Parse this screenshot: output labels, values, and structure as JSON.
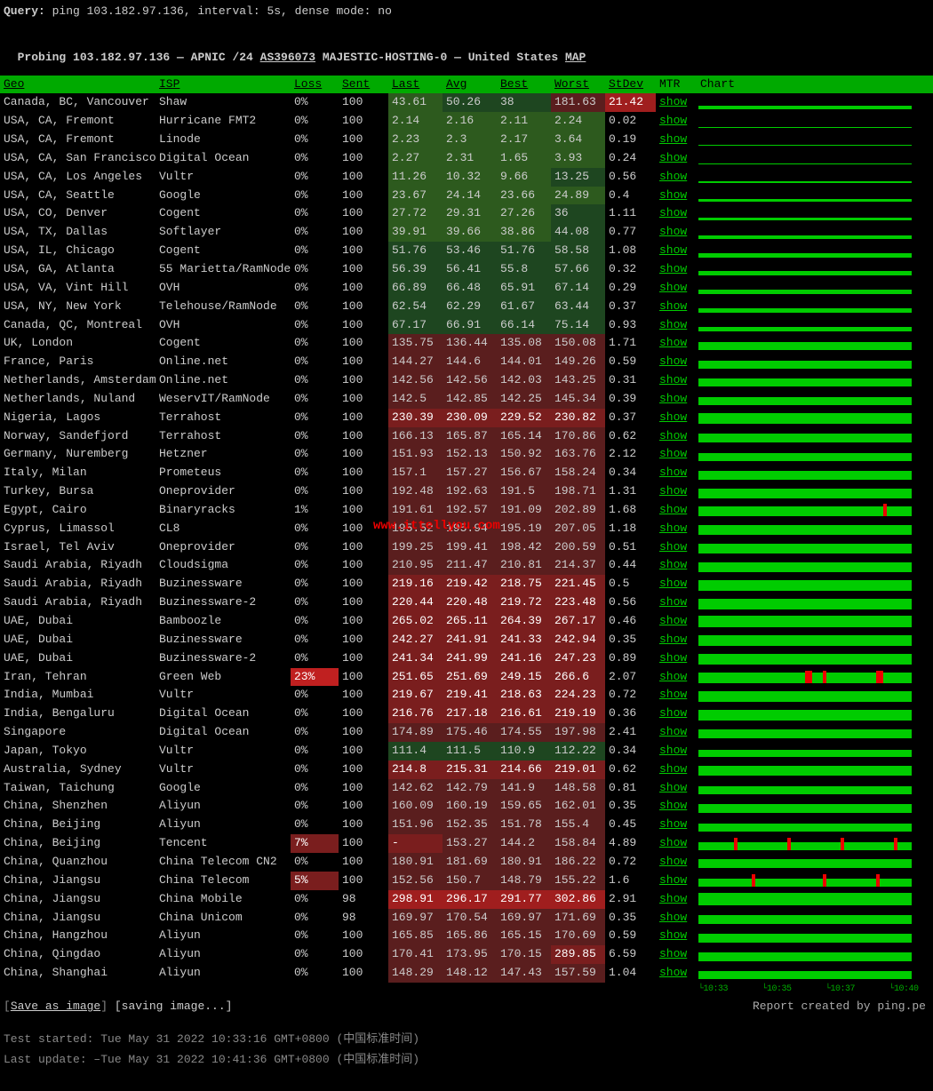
{
  "header": {
    "query_label": "Query: ",
    "query_value": "ping 103.182.97.136, interval: 5s, dense mode: no",
    "probe_line_prefix": "Probing 103.182.97.136 — APNIC /24 ",
    "asn": "AS396073",
    "probe_line_mid": " MAJESTIC-HOSTING-0 — United States ",
    "map": "MAP"
  },
  "columns": {
    "geo": "Geo",
    "isp": "ISP",
    "loss": "Loss",
    "sent": "Sent",
    "last": "Last",
    "avg": "Avg",
    "best": "Best",
    "worst": "Worst",
    "stdev": "StDev",
    "mtr": "MTR",
    "chart": "Chart"
  },
  "mtr_label": "show",
  "watermark": "www.ittellyou.com",
  "axis_labels": [
    "10:33",
    "10:35",
    "10:37",
    "10:40"
  ],
  "footer": {
    "save": "Save as image",
    "saving": "[saving image...]",
    "report_by": "Report created by ping.pe",
    "started_label": "Test started: ",
    "started": "Tue May 31 2022 10:33:16 GMT+0800 (中国标准时间)",
    "updated_label": "Last update: –",
    "updated": "Tue May 31 2022 10:41:36 GMT+0800 (中国标准时间)"
  },
  "rows": [
    {
      "geo": "Canada, BC, Vancouver",
      "isp": "Shaw",
      "loss": "0%",
      "sent": "100",
      "last": "43.61",
      "avg": "50.26",
      "best": "38",
      "worst": "181.63",
      "stdev": "21.42",
      "stc": "r2",
      "pc": [
        "g1",
        "g0",
        "g0",
        "r0"
      ],
      "ch": {
        "h": 4,
        "loss": []
      }
    },
    {
      "geo": "USA, CA, Fremont",
      "isp": "Hurricane FMT2",
      "loss": "0%",
      "sent": "100",
      "last": "2.14",
      "avg": "2.16",
      "best": "2.11",
      "worst": "2.24",
      "stdev": "0.02",
      "pc": [
        "g1",
        "g1",
        "g1",
        "g1"
      ],
      "ch": {
        "h": 1,
        "loss": []
      }
    },
    {
      "geo": "USA, CA, Fremont",
      "isp": "Linode",
      "loss": "0%",
      "sent": "100",
      "last": "2.23",
      "avg": "2.3",
      "best": "2.17",
      "worst": "3.64",
      "stdev": "0.19",
      "pc": [
        "g1",
        "g1",
        "g1",
        "g1"
      ],
      "ch": {
        "h": 1,
        "loss": []
      }
    },
    {
      "geo": "USA, CA, San Francisco",
      "isp": "Digital Ocean",
      "loss": "0%",
      "sent": "100",
      "last": "2.27",
      "avg": "2.31",
      "best": "1.65",
      "worst": "3.93",
      "stdev": "0.24",
      "pc": [
        "g1",
        "g1",
        "g1",
        "g1"
      ],
      "ch": {
        "h": 1,
        "loss": []
      }
    },
    {
      "geo": "USA, CA, Los Angeles",
      "isp": "Vultr",
      "loss": "0%",
      "sent": "100",
      "last": "11.26",
      "avg": "10.32",
      "best": "9.66",
      "worst": "13.25",
      "stdev": "0.56",
      "pc": [
        "g1",
        "g1",
        "g1",
        "g0"
      ],
      "ch": {
        "h": 2,
        "loss": []
      }
    },
    {
      "geo": "USA, CA, Seattle",
      "isp": "Google",
      "loss": "0%",
      "sent": "100",
      "last": "23.67",
      "avg": "24.14",
      "best": "23.66",
      "worst": "24.89",
      "stdev": "0.4",
      "pc": [
        "g1",
        "g1",
        "g1",
        "g1"
      ],
      "ch": {
        "h": 3,
        "loss": []
      }
    },
    {
      "geo": "USA, CO, Denver",
      "isp": "Cogent",
      "loss": "0%",
      "sent": "100",
      "last": "27.72",
      "avg": "29.31",
      "best": "27.26",
      "worst": "36",
      "stdev": "1.11",
      "pc": [
        "g1",
        "g1",
        "g1",
        "g0"
      ],
      "ch": {
        "h": 3,
        "loss": []
      }
    },
    {
      "geo": "USA, TX, Dallas",
      "isp": "Softlayer",
      "loss": "0%",
      "sent": "100",
      "last": "39.91",
      "avg": "39.66",
      "best": "38.86",
      "worst": "44.08",
      "stdev": "0.77",
      "pc": [
        "g1",
        "g1",
        "g1",
        "g0"
      ],
      "ch": {
        "h": 4,
        "loss": []
      }
    },
    {
      "geo": "USA, IL, Chicago",
      "isp": "Cogent",
      "loss": "0%",
      "sent": "100",
      "last": "51.76",
      "avg": "53.46",
      "best": "51.76",
      "worst": "58.58",
      "stdev": "1.08",
      "pc": [
        "g0",
        "g0",
        "g0",
        "g0"
      ],
      "ch": {
        "h": 5,
        "loss": []
      }
    },
    {
      "geo": "USA, GA, Atlanta",
      "isp": "55 Marietta/RamNode",
      "loss": "0%",
      "sent": "100",
      "last": "56.39",
      "avg": "56.41",
      "best": "55.8",
      "worst": "57.66",
      "stdev": "0.32",
      "pc": [
        "g0",
        "g0",
        "g0",
        "g0"
      ],
      "ch": {
        "h": 5,
        "loss": []
      }
    },
    {
      "geo": "USA, VA, Vint Hill",
      "isp": "OVH",
      "loss": "0%",
      "sent": "100",
      "last": "66.89",
      "avg": "66.48",
      "best": "65.91",
      "worst": "67.14",
      "stdev": "0.29",
      "pc": [
        "g0",
        "g0",
        "g0",
        "g0"
      ],
      "ch": {
        "h": 5,
        "loss": []
      }
    },
    {
      "geo": "USA, NY, New York",
      "isp": "Telehouse/RamNode",
      "loss": "0%",
      "sent": "100",
      "last": "62.54",
      "avg": "62.29",
      "best": "61.67",
      "worst": "63.44",
      "stdev": "0.37",
      "pc": [
        "g0",
        "g0",
        "g0",
        "g0"
      ],
      "ch": {
        "h": 5,
        "loss": []
      }
    },
    {
      "geo": "Canada, QC, Montreal",
      "isp": "OVH",
      "loss": "0%",
      "sent": "100",
      "last": "67.17",
      "avg": "66.91",
      "best": "66.14",
      "worst": "75.14",
      "stdev": "0.93",
      "pc": [
        "g0",
        "g0",
        "g0",
        "g0"
      ],
      "ch": {
        "h": 5,
        "loss": []
      }
    },
    {
      "geo": "UK, London",
      "isp": "Cogent",
      "loss": "0%",
      "sent": "100",
      "last": "135.75",
      "avg": "136.44",
      "best": "135.08",
      "worst": "150.08",
      "stdev": "1.71",
      "pc": [
        "r0",
        "r0",
        "r0",
        "r0"
      ],
      "ch": {
        "h": 9,
        "loss": []
      }
    },
    {
      "geo": "France, Paris",
      "isp": "Online.net",
      "loss": "0%",
      "sent": "100",
      "last": "144.27",
      "avg": "144.6",
      "best": "144.01",
      "worst": "149.26",
      "stdev": "0.59",
      "pc": [
        "r0",
        "r0",
        "r0",
        "r0"
      ],
      "ch": {
        "h": 9,
        "loss": []
      }
    },
    {
      "geo": "Netherlands, Amsterdam",
      "isp": "Online.net",
      "loss": "0%",
      "sent": "100",
      "last": "142.56",
      "avg": "142.56",
      "best": "142.03",
      "worst": "143.25",
      "stdev": "0.31",
      "pc": [
        "r0",
        "r0",
        "r0",
        "r0"
      ],
      "ch": {
        "h": 9,
        "loss": []
      }
    },
    {
      "geo": "Netherlands, Nuland",
      "isp": "WeservIT/RamNode",
      "loss": "0%",
      "sent": "100",
      "last": "142.5",
      "avg": "142.85",
      "best": "142.25",
      "worst": "145.34",
      "stdev": "0.39",
      "pc": [
        "r0",
        "r0",
        "r0",
        "r0"
      ],
      "ch": {
        "h": 9,
        "loss": []
      }
    },
    {
      "geo": "Nigeria, Lagos",
      "isp": "Terrahost",
      "loss": "0%",
      "sent": "100",
      "last": "230.39",
      "avg": "230.09",
      "best": "229.52",
      "worst": "230.82",
      "stdev": "0.37",
      "pc": [
        "r1",
        "r1",
        "r1",
        "r1"
      ],
      "ch": {
        "h": 12,
        "loss": []
      }
    },
    {
      "geo": "Norway, Sandefjord",
      "isp": "Terrahost",
      "loss": "0%",
      "sent": "100",
      "last": "166.13",
      "avg": "165.87",
      "best": "165.14",
      "worst": "170.86",
      "stdev": "0.62",
      "pc": [
        "r0",
        "r0",
        "r0",
        "r0"
      ],
      "ch": {
        "h": 10,
        "loss": []
      }
    },
    {
      "geo": "Germany, Nuremberg",
      "isp": "Hetzner",
      "loss": "0%",
      "sent": "100",
      "last": "151.93",
      "avg": "152.13",
      "best": "150.92",
      "worst": "163.76",
      "stdev": "2.12",
      "pc": [
        "r0",
        "r0",
        "r0",
        "r0"
      ],
      "ch": {
        "h": 9,
        "loss": []
      }
    },
    {
      "geo": "Italy, Milan",
      "isp": "Prometeus",
      "loss": "0%",
      "sent": "100",
      "last": "157.1",
      "avg": "157.27",
      "best": "156.67",
      "worst": "158.24",
      "stdev": "0.34",
      "pc": [
        "r0",
        "r0",
        "r0",
        "r0"
      ],
      "ch": {
        "h": 10,
        "loss": []
      }
    },
    {
      "geo": "Turkey, Bursa",
      "isp": "Oneprovider",
      "loss": "0%",
      "sent": "100",
      "last": "192.48",
      "avg": "192.63",
      "best": "191.5",
      "worst": "198.71",
      "stdev": "1.31",
      "pc": [
        "r0",
        "r0",
        "r0",
        "r0"
      ],
      "ch": {
        "h": 11,
        "loss": []
      }
    },
    {
      "geo": "Egypt, Cairo",
      "isp": "Binaryracks",
      "loss": "1%",
      "sent": "100",
      "last": "191.61",
      "avg": "192.57",
      "best": "191.09",
      "worst": "202.89",
      "stdev": "1.68",
      "pc": [
        "r0",
        "r0",
        "r0",
        "r0"
      ],
      "ch": {
        "h": 11,
        "loss": [
          52
        ]
      }
    },
    {
      "geo": "Cyprus, Limassol",
      "isp": "CL8",
      "loss": "0%",
      "sent": "100",
      "last": "195.52",
      "avg": "195.94",
      "best": "195.19",
      "worst": "207.05",
      "stdev": "1.18",
      "pc": [
        "r0",
        "r0",
        "r0",
        "r0"
      ],
      "ch": {
        "h": 11,
        "loss": []
      }
    },
    {
      "geo": "Israel, Tel Aviv",
      "isp": "Oneprovider",
      "loss": "0%",
      "sent": "100",
      "last": "199.25",
      "avg": "199.41",
      "best": "198.42",
      "worst": "200.59",
      "stdev": "0.51",
      "pc": [
        "r0",
        "r0",
        "r0",
        "r0"
      ],
      "ch": {
        "h": 11,
        "loss": []
      }
    },
    {
      "geo": "Saudi Arabia, Riyadh",
      "isp": "Cloudsigma",
      "loss": "0%",
      "sent": "100",
      "last": "210.95",
      "avg": "211.47",
      "best": "210.81",
      "worst": "214.37",
      "stdev": "0.44",
      "pc": [
        "r0",
        "r0",
        "r0",
        "r0"
      ],
      "ch": {
        "h": 11,
        "loss": []
      }
    },
    {
      "geo": "Saudi Arabia, Riyadh",
      "isp": "Buzinessware",
      "loss": "0%",
      "sent": "100",
      "last": "219.16",
      "avg": "219.42",
      "best": "218.75",
      "worst": "221.45",
      "stdev": "0.5",
      "pc": [
        "r1",
        "r1",
        "r1",
        "r1"
      ],
      "ch": {
        "h": 12,
        "loss": []
      }
    },
    {
      "geo": "Saudi Arabia, Riyadh",
      "isp": "Buzinessware-2",
      "loss": "0%",
      "sent": "100",
      "last": "220.44",
      "avg": "220.48",
      "best": "219.72",
      "worst": "223.48",
      "stdev": "0.56",
      "pc": [
        "r1",
        "r1",
        "r1",
        "r1"
      ],
      "ch": {
        "h": 12,
        "loss": []
      }
    },
    {
      "geo": "UAE, Dubai",
      "isp": "Bamboozle",
      "loss": "0%",
      "sent": "100",
      "last": "265.02",
      "avg": "265.11",
      "best": "264.39",
      "worst": "267.17",
      "stdev": "0.46",
      "pc": [
        "r1",
        "r1",
        "r1",
        "r1"
      ],
      "ch": {
        "h": 13,
        "loss": []
      }
    },
    {
      "geo": "UAE, Dubai",
      "isp": "Buzinessware",
      "loss": "0%",
      "sent": "100",
      "last": "242.27",
      "avg": "241.91",
      "best": "241.33",
      "worst": "242.94",
      "stdev": "0.35",
      "pc": [
        "r1",
        "r1",
        "r1",
        "r1"
      ],
      "ch": {
        "h": 12,
        "loss": []
      }
    },
    {
      "geo": "UAE, Dubai",
      "isp": "Buzinessware-2",
      "loss": "0%",
      "sent": "100",
      "last": "241.34",
      "avg": "241.99",
      "best": "241.16",
      "worst": "247.23",
      "stdev": "0.89",
      "pc": [
        "r1",
        "r1",
        "r1",
        "r1"
      ],
      "ch": {
        "h": 12,
        "loss": []
      }
    },
    {
      "geo": "Iran, Tehran",
      "isp": "Green Web",
      "loss": "23%",
      "lc": "r3",
      "sent": "100",
      "last": "251.65",
      "avg": "251.69",
      "best": "249.15",
      "worst": "266.6",
      "stdev": "2.07",
      "pc": [
        "r1",
        "r1",
        "r1",
        "r1"
      ],
      "ch": {
        "h": 12,
        "loss": [
          30,
          31,
          35,
          50,
          51,
          60,
          61,
          62,
          70,
          75,
          80,
          81,
          85,
          90,
          91,
          95
        ]
      }
    },
    {
      "geo": "India, Mumbai",
      "isp": "Vultr",
      "loss": "0%",
      "sent": "100",
      "last": "219.67",
      "avg": "219.41",
      "best": "218.63",
      "worst": "224.23",
      "stdev": "0.72",
      "pc": [
        "r1",
        "r1",
        "r1",
        "r1"
      ],
      "ch": {
        "h": 12,
        "loss": []
      }
    },
    {
      "geo": "India, Bengaluru",
      "isp": "Digital Ocean",
      "loss": "0%",
      "sent": "100",
      "last": "216.76",
      "avg": "217.18",
      "best": "216.61",
      "worst": "219.19",
      "stdev": "0.36",
      "pc": [
        "r1",
        "r1",
        "r1",
        "r1"
      ],
      "ch": {
        "h": 12,
        "loss": []
      }
    },
    {
      "geo": "Singapore",
      "isp": "Digital Ocean",
      "loss": "0%",
      "sent": "100",
      "last": "174.89",
      "avg": "175.46",
      "best": "174.55",
      "worst": "197.98",
      "stdev": "2.41",
      "pc": [
        "r0",
        "r0",
        "r0",
        "r0"
      ],
      "ch": {
        "h": 10,
        "loss": []
      }
    },
    {
      "geo": "Japan, Tokyo",
      "isp": "Vultr",
      "loss": "0%",
      "sent": "100",
      "last": "111.4",
      "avg": "111.5",
      "best": "110.9",
      "worst": "112.22",
      "stdev": "0.34",
      "pc": [
        "g0",
        "g0",
        "g0",
        "g0"
      ],
      "ch": {
        "h": 8,
        "loss": []
      }
    },
    {
      "geo": "Australia, Sydney",
      "isp": "Vultr",
      "loss": "0%",
      "sent": "100",
      "last": "214.8",
      "avg": "215.31",
      "best": "214.66",
      "worst": "219.01",
      "stdev": "0.62",
      "pc": [
        "r1",
        "r1",
        "r1",
        "r1"
      ],
      "ch": {
        "h": 11,
        "loss": []
      }
    },
    {
      "geo": "Taiwan, Taichung",
      "isp": "Google",
      "loss": "0%",
      "sent": "100",
      "last": "142.62",
      "avg": "142.79",
      "best": "141.9",
      "worst": "148.58",
      "stdev": "0.81",
      "pc": [
        "r0",
        "r0",
        "r0",
        "r0"
      ],
      "ch": {
        "h": 9,
        "loss": []
      }
    },
    {
      "geo": "China, Shenzhen",
      "isp": "Aliyun",
      "loss": "0%",
      "sent": "100",
      "last": "160.09",
      "avg": "160.19",
      "best": "159.65",
      "worst": "162.01",
      "stdev": "0.35",
      "pc": [
        "r0",
        "r0",
        "r0",
        "r0"
      ],
      "ch": {
        "h": 10,
        "loss": []
      }
    },
    {
      "geo": "China, Beijing",
      "isp": "Aliyun",
      "loss": "0%",
      "sent": "100",
      "last": "151.96",
      "avg": "152.35",
      "best": "151.78",
      "worst": "155.4",
      "stdev": "0.45",
      "pc": [
        "r0",
        "r0",
        "r0",
        "r0"
      ],
      "ch": {
        "h": 9,
        "loss": []
      }
    },
    {
      "geo": "China, Beijing",
      "isp": "Tencent",
      "loss": "7%",
      "lc": "r1",
      "sent": "100",
      "last": "-",
      "avg": "153.27",
      "best": "144.2",
      "worst": "158.84",
      "stdev": "4.89",
      "pc": [
        "r1",
        "r0",
        "r0",
        "r0"
      ],
      "ch": {
        "h": 9,
        "loss": [
          10,
          25,
          40,
          55,
          70,
          85,
          98
        ]
      }
    },
    {
      "geo": "China, Quanzhou",
      "isp": "China Telecom CN2",
      "loss": "0%",
      "sent": "100",
      "last": "180.91",
      "avg": "181.69",
      "best": "180.91",
      "worst": "186.22",
      "stdev": "0.72",
      "pc": [
        "r0",
        "r0",
        "r0",
        "r0"
      ],
      "ch": {
        "h": 10,
        "loss": []
      }
    },
    {
      "geo": "China, Jiangsu",
      "isp": "China Telecom",
      "loss": "5%",
      "lc": "r1",
      "sent": "100",
      "last": "152.56",
      "avg": "150.7",
      "best": "148.79",
      "worst": "155.22",
      "stdev": "1.6",
      "pc": [
        "r0",
        "r0",
        "r0",
        "r0"
      ],
      "ch": {
        "h": 9,
        "loss": [
          15,
          35,
          50,
          65,
          80
        ]
      }
    },
    {
      "geo": "China, Jiangsu",
      "isp": "China Mobile",
      "loss": "0%",
      "sent": "98",
      "last": "298.91",
      "avg": "296.17",
      "best": "291.77",
      "worst": "302.86",
      "stdev": "2.91",
      "pc": [
        "r2",
        "r2",
        "r2",
        "r2"
      ],
      "ch": {
        "h": 14,
        "loss": []
      }
    },
    {
      "geo": "China, Jiangsu",
      "isp": "China Unicom",
      "loss": "0%",
      "sent": "98",
      "last": "169.97",
      "avg": "170.54",
      "best": "169.97",
      "worst": "171.69",
      "stdev": "0.35",
      "pc": [
        "r0",
        "r0",
        "r0",
        "r0"
      ],
      "ch": {
        "h": 10,
        "loss": []
      }
    },
    {
      "geo": "China, Hangzhou",
      "isp": "Aliyun",
      "loss": "0%",
      "sent": "100",
      "last": "165.85",
      "avg": "165.86",
      "best": "165.15",
      "worst": "170.69",
      "stdev": "0.59",
      "pc": [
        "r0",
        "r0",
        "r0",
        "r0"
      ],
      "ch": {
        "h": 10,
        "loss": []
      }
    },
    {
      "geo": "China, Qingdao",
      "isp": "Aliyun",
      "loss": "0%",
      "sent": "100",
      "last": "170.41",
      "avg": "173.95",
      "best": "170.15",
      "worst": "289.85",
      "stdev": "6.59",
      "pc": [
        "r0",
        "r0",
        "r0",
        "r1"
      ],
      "ch": {
        "h": 10,
        "loss": []
      }
    },
    {
      "geo": "China, Shanghai",
      "isp": "Aliyun",
      "loss": "0%",
      "sent": "100",
      "last": "148.29",
      "avg": "148.12",
      "best": "147.43",
      "worst": "157.59",
      "stdev": "1.04",
      "pc": [
        "r0",
        "r0",
        "r0",
        "r0"
      ],
      "ch": {
        "h": 9,
        "loss": []
      }
    }
  ]
}
